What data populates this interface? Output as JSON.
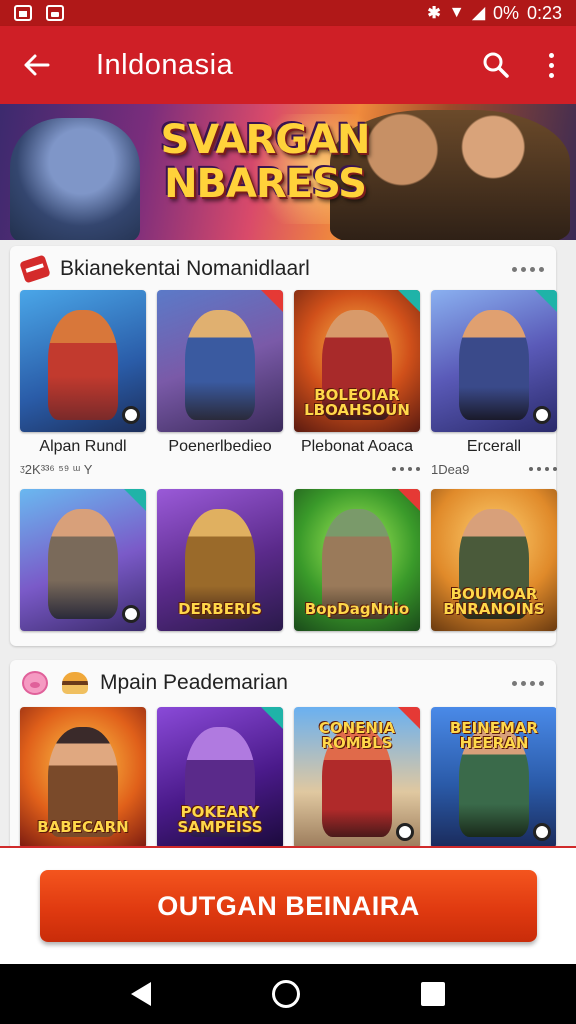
{
  "status_bar": {
    "battery": "0%",
    "time": "0:23"
  },
  "app_bar": {
    "title": "Inldonasia"
  },
  "hero": {
    "title_line1": "SVARGAN",
    "title_line2": "NBARESS"
  },
  "sections": [
    {
      "title": "Bkianekentai Nomanidlaarl",
      "rows": [
        [
          {
            "name": "Alpan Rundl",
            "sub": "ᶾ2K³³⁶ ⁵⁹  ᵚ Y",
            "logo": ""
          },
          {
            "name": "Poenerlbedieo",
            "sub": "",
            "logo": ""
          },
          {
            "name": "Plebonat Aoaca",
            "sub": "",
            "logo": "BOLEOIAR LBOAHSOUN"
          },
          {
            "name": "Ercerall",
            "sub": "1Dea9",
            "logo": ""
          }
        ],
        [
          {
            "name": "",
            "sub": "",
            "logo": ""
          },
          {
            "name": "",
            "sub": "",
            "logo": "DERBERIS"
          },
          {
            "name": "",
            "sub": "",
            "logo": "BopDagNnio"
          },
          {
            "name": "",
            "sub": "",
            "logo": "BOUMOAR BNRANOINS"
          }
        ]
      ]
    },
    {
      "title": "Mpain Peademarian",
      "rows": [
        [
          {
            "name": "",
            "sub": "",
            "logo": "BABECARN"
          },
          {
            "name": "",
            "sub": "",
            "logo": "POKEARY SAMPEISS"
          },
          {
            "name": "",
            "sub": "",
            "logo": "CONENIA ROMBLS"
          },
          {
            "name": "",
            "sub": "",
            "logo": "BEINEMAR HEERAN"
          }
        ]
      ]
    }
  ],
  "cta": {
    "label": "OUTGAN BEINAIRA"
  },
  "colors": {
    "app_bar": "#cf1f26",
    "status_bar": "#b01818",
    "cta_button": "#e53c12"
  }
}
